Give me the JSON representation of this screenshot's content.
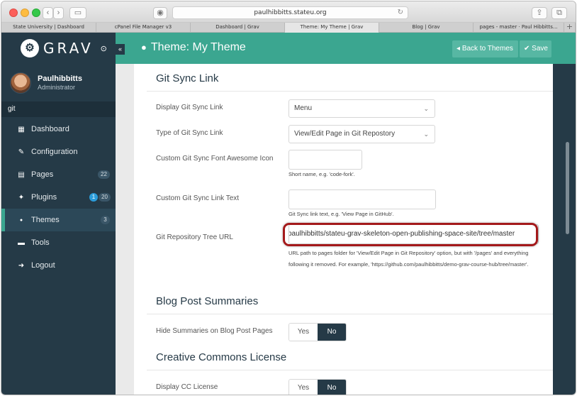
{
  "browser": {
    "url": "paulhibbitts.stateu.org",
    "tabs": [
      {
        "label": "State University | Dashboard",
        "active": false
      },
      {
        "label": "cPanel File Manager v3",
        "active": false
      },
      {
        "label": "Dashboard | Grav",
        "active": false
      },
      {
        "label": "Theme: My Theme | Grav",
        "active": true
      },
      {
        "label": "Blog | Grav",
        "active": false
      },
      {
        "label": "pages - master · Paul Hibbitts...",
        "active": false
      }
    ],
    "new_tab_label": "+"
  },
  "sidebar": {
    "logo_text": "GRAV",
    "user": {
      "name": "Paulhibbitts",
      "role": "Administrator"
    },
    "search_value": "git",
    "items": [
      {
        "label": "Dashboard",
        "icon": "grid-icon",
        "glyph": "▦"
      },
      {
        "label": "Configuration",
        "icon": "wrench-icon",
        "glyph": "✎"
      },
      {
        "label": "Pages",
        "icon": "file-icon",
        "glyph": "▤",
        "badge": "22"
      },
      {
        "label": "Plugins",
        "icon": "plug-icon",
        "glyph": "✦",
        "badge_blue": "1",
        "badge": "20"
      },
      {
        "label": "Themes",
        "icon": "drop-icon",
        "glyph": "●",
        "badge": "3",
        "active": true
      },
      {
        "label": "Tools",
        "icon": "briefcase-icon",
        "glyph": "▬"
      },
      {
        "label": "Logout",
        "icon": "logout-icon",
        "glyph": "➜"
      }
    ]
  },
  "header": {
    "title": "Theme: My Theme",
    "back_label": "Back to Themes",
    "save_label": "Save",
    "accent_color": "#3ba690",
    "sidebar_color": "#253a47"
  },
  "form": {
    "git_sync_title": "Git Sync Link",
    "display_label": "Display Git Sync Link",
    "display_value": "Menu",
    "type_label": "Type of Git Sync Link",
    "type_value": "View/Edit Page in Git Repostory",
    "icon_label": "Custom Git Sync Font Awesome Icon",
    "icon_value": "",
    "icon_help": "Short name, e.g. 'code-fork'.",
    "text_label": "Custom Git Sync Link Text",
    "text_value": "",
    "text_help": "Git Sync link text, e.g. 'View Page in GitHub'.",
    "tree_label": "Git Repository Tree URL",
    "tree_value": "paulhibbitts/stateu-grav-skeleton-open-publishing-space-site/tree/master",
    "tree_help": "URL path to pages folder for 'View/Edit Page in Git Repository' option, but with '/pages' and everything following it removed. For example, 'https://github.com/paulhibbitts/demo-grav-course-hub/tree/master'.",
    "blog_title": "Blog Post Summaries",
    "hide_label": "Hide Summaries on Blog Post Pages",
    "cc_title": "Creative Commons License",
    "cc_label": "Display CC License",
    "yes_label": "Yes",
    "no_label": "No"
  }
}
